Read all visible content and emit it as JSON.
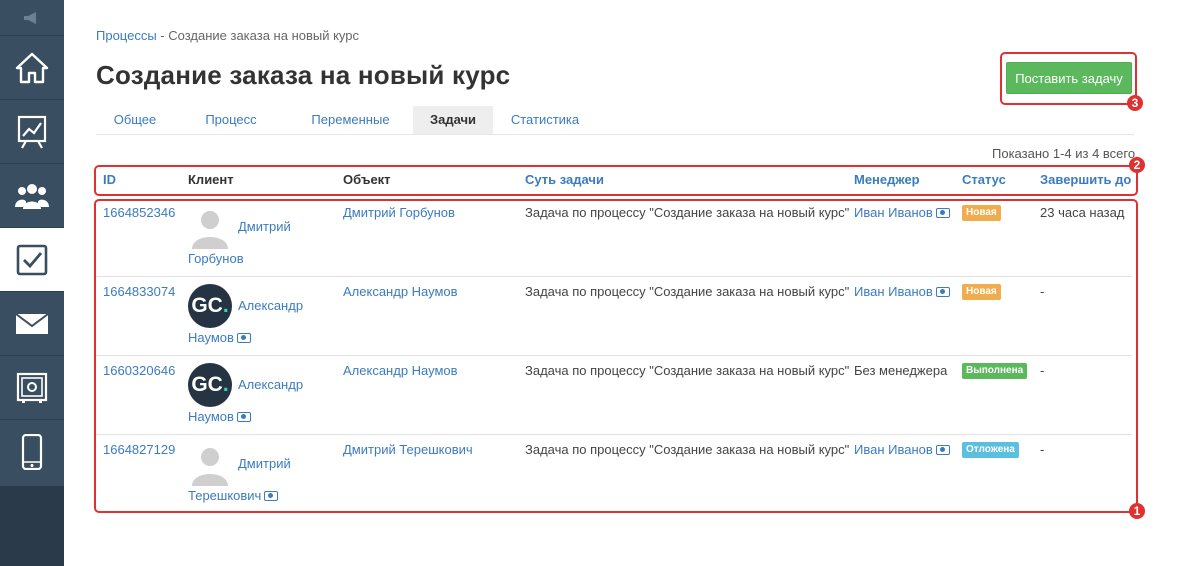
{
  "sidebar": {
    "items": [
      {
        "icon": "home-icon"
      },
      {
        "icon": "chart-icon"
      },
      {
        "icon": "users-icon"
      },
      {
        "icon": "checkbox-icon"
      },
      {
        "icon": "mail-icon"
      },
      {
        "icon": "safe-icon"
      },
      {
        "icon": "phone-icon"
      }
    ],
    "active_item": "checkbox-icon",
    "top_icon": "megaphone-icon"
  },
  "breadcrumb": {
    "parent": "Процессы",
    "separator": " - ",
    "current": "Создание заказа на новый курс"
  },
  "page_title": "Создание заказа на новый курс",
  "actions": {
    "create_task": "Поставить задачу"
  },
  "tabs": [
    {
      "label": "Общее"
    },
    {
      "label": "Процесс"
    },
    {
      "label": "Переменные"
    },
    {
      "label": "Задачи",
      "active": true
    },
    {
      "label": "Статистика"
    }
  ],
  "table": {
    "shown_count": "Показано 1-4 из 4 всего.",
    "headers": {
      "id": "ID",
      "client": "Клиент",
      "object": "Объект",
      "essence": "Суть задачи",
      "manager": "Менеджер",
      "status": "Статус",
      "deadline": "Завершить до"
    },
    "rows": [
      {
        "id": "1664852346",
        "client_first": "Дмитрий",
        "client_last": "Горбунов",
        "avatar": "placeholder",
        "object": "Дмитрий Горбунов",
        "essence": "Задача по процессу \"Создание заказа на новый курс\"",
        "manager": "Иван Иванов",
        "manager_icon": "money-icon",
        "status": "Новая",
        "deadline": "23 часа назад"
      },
      {
        "id": "1664833074",
        "client_first": "Александр",
        "client_last": "Наумов",
        "avatar": "GC.",
        "object": "Александр Наумов",
        "essence": "Задача по процессу \"Создание заказа на новый курс\"",
        "manager": "Иван Иванов",
        "manager_icon": "money-icon",
        "status": "Новая",
        "deadline": "-"
      },
      {
        "id": "1660320646",
        "client_first": "Александр",
        "client_last": "Наумов",
        "avatar": "GC.",
        "object": "Александр Наумов",
        "essence": "Задача по процессу \"Создание заказа на новый курс\"",
        "manager": "Без менеджера",
        "status": "Выполнена",
        "deadline": "-"
      },
      {
        "id": "1664827129",
        "client_first": "Дмитрий",
        "client_last": "Терешкович",
        "avatar": "placeholder",
        "object": "Дмитрий Терешкович",
        "essence": "Задача по процессу \"Создание заказа на новый курс\"",
        "manager": "Иван Иванов",
        "manager_icon": "money-icon",
        "status": "Отложена",
        "deadline": "-"
      }
    ]
  },
  "status_colors": {
    "Новая": "#f0ad4e",
    "Выполнена": "#5cb85c",
    "Отложена": "#5bc0de"
  },
  "annotations": [
    {
      "number": "1",
      "target": "table-rows"
    },
    {
      "number": "2",
      "target": "table-header"
    },
    {
      "number": "3",
      "target": "create-task-button"
    }
  ]
}
